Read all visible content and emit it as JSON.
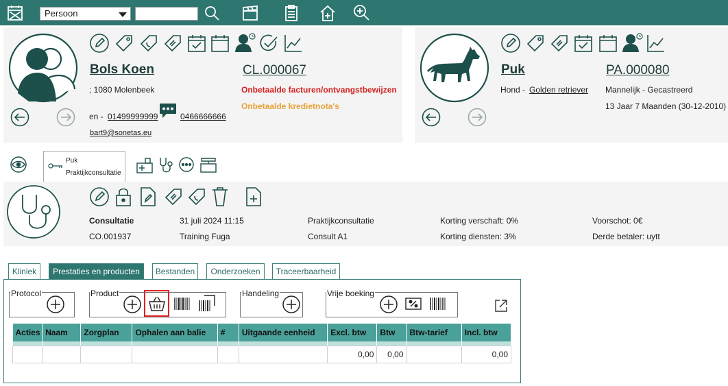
{
  "topbar": {
    "select_value": "Persoon",
    "search_value": "",
    "icons": [
      "calendar-x-icon",
      "search-icon",
      "clapperboard-icon",
      "clipboard-list-icon",
      "home-plus-icon",
      "zoom-in-icon"
    ]
  },
  "client": {
    "name": "Bols Koen",
    "code": "CL.000067",
    "address": "; 1080 Molenbeek",
    "phone_prefix": "en -",
    "phone1": "01499999999",
    "phone2": "0466666666",
    "email": "bart9@sonetas.eu",
    "alert_unpaid": "Onbetaalde facturen/ontvangstbewijzen",
    "alert_credit": "Onbetaalde kredietnota's"
  },
  "patient": {
    "name": "Puk",
    "code": "PA.000080",
    "species_prefix": "Hond -",
    "breed": "Golden retriever",
    "sex": "Mannelijk - Gecastreerd",
    "age": "13 Jaar 7 Maanden (30-12-2010)"
  },
  "consult_tab": {
    "line1": "Puk",
    "line2": "Praktijkconsultatie"
  },
  "consult": {
    "type_label": "Consultatie",
    "number": "CO.001937",
    "datetime": "31 juli 2024 11:15",
    "location": "Training Fuga",
    "category": "Praktijkconsultatie",
    "vet": "Consult A1",
    "discount_given": "Korting verschaft: 0%",
    "discount_services": "Korting diensten: 3%",
    "advance": "Voorschot: 0€",
    "third_payer": "Derde betaler: uytt"
  },
  "tabs": [
    {
      "label": "Kliniek",
      "active": false
    },
    {
      "label": "Prestaties en producten",
      "active": true
    },
    {
      "label": "Bestanden",
      "active": false
    },
    {
      "label": "Onderzoeken",
      "active": false
    },
    {
      "label": "Traceerbaarheid",
      "active": false
    }
  ],
  "groups": {
    "protocol": "Protocol",
    "product": "Product",
    "handeling": "Handeling",
    "vrije_boeking": "Vrije boeking"
  },
  "table": {
    "columns": [
      "Acties",
      "Naam",
      "Zorgplan",
      "Ophalen aan balie",
      "#",
      "Uitgaande eenheid",
      "Excl. btw",
      "Btw",
      "Btw-tarief",
      "Incl. btw"
    ],
    "row": [
      "",
      "",
      "",
      "",
      "",
      "",
      "0,00",
      "0,00",
      "",
      "0,00"
    ]
  },
  "colors": {
    "accent": "#2e7670",
    "header": "#4aa19a",
    "alert_red": "#d42020",
    "alert_orange": "#e8a23a",
    "highlight": "#e02020"
  }
}
